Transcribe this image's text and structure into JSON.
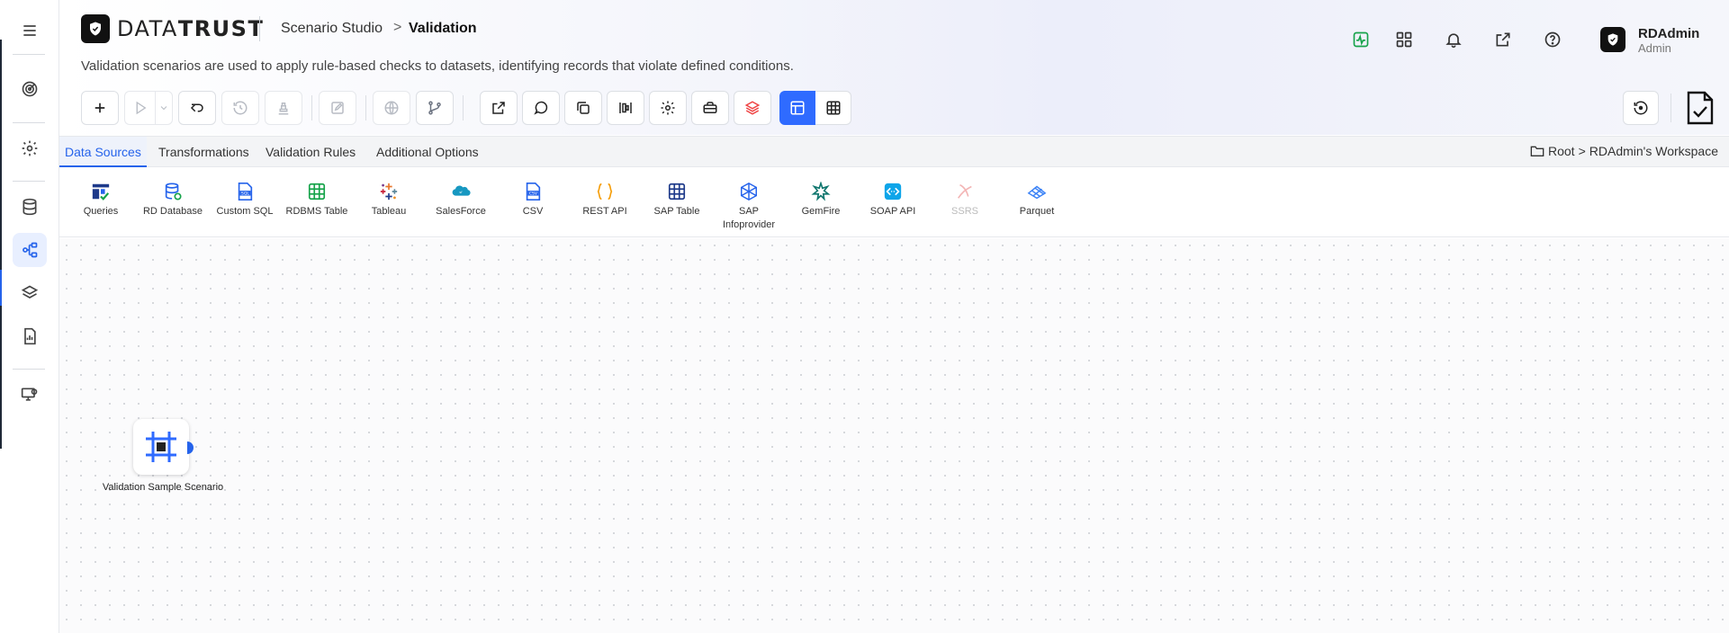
{
  "app": {
    "logo_text_light": "DATA",
    "logo_text_bold": "TRUST",
    "breadcrumb": [
      "Scenario Studio",
      "Validation"
    ],
    "breadcrumb_separator": ">",
    "subtitle": "Validation scenarios are used to apply rule-based checks to datasets, identifying records that violate defined conditions."
  },
  "header_icons": [
    "activity-icon",
    "apps-grid-icon",
    "bell-icon",
    "external-link-icon",
    "help-icon"
  ],
  "user": {
    "name": "RDAdmin",
    "role": "Admin"
  },
  "sidebar": {
    "items": [
      {
        "icon": "menu-icon"
      },
      {
        "icon": "target-icon"
      },
      {
        "icon": "gear-icon"
      },
      {
        "icon": "database-icon"
      },
      {
        "icon": "workflow-icon",
        "active": true
      },
      {
        "icon": "layers-icon"
      },
      {
        "icon": "report-icon"
      },
      {
        "icon": "monitor-settings-icon"
      }
    ]
  },
  "toolbar": {
    "buttons": [
      "add",
      "run",
      "run-dropdown",
      "undo",
      "history",
      "stamp",
      "edit",
      "globe",
      "branch",
      "export",
      "comment",
      "copy",
      "align",
      "settings",
      "briefcase",
      "layers",
      "layout-view",
      "table-view"
    ],
    "active_view": "layout-view"
  },
  "tabs": {
    "items": [
      "Data Sources",
      "Transformations",
      "Validation Rules",
      "Additional Options"
    ],
    "active": "Data Sources"
  },
  "workspace": {
    "root": "Root",
    "separator": ">",
    "name": "RDAdmin's Workspace"
  },
  "sources": [
    {
      "label": "Queries",
      "icon": "queries-icon"
    },
    {
      "label": "RD Database",
      "icon": "rd-database-icon"
    },
    {
      "label": "Custom SQL",
      "icon": "custom-sql-icon"
    },
    {
      "label": "RDBMS Table",
      "icon": "rdbms-table-icon"
    },
    {
      "label": "Tableau",
      "icon": "tableau-icon"
    },
    {
      "label": "SalesForce",
      "icon": "salesforce-icon"
    },
    {
      "label": "CSV",
      "icon": "csv-icon"
    },
    {
      "label": "REST API",
      "icon": "rest-api-icon"
    },
    {
      "label": "SAP Table",
      "icon": "sap-table-icon"
    },
    {
      "label": "SAP Infoprovider",
      "icon": "sap-infoprovider-icon"
    },
    {
      "label": "GemFire",
      "icon": "gemfire-icon"
    },
    {
      "label": "SOAP API",
      "icon": "soap-api-icon"
    },
    {
      "label": "SSRS",
      "icon": "ssrs-icon",
      "disabled": true
    },
    {
      "label": "Parquet",
      "icon": "parquet-icon"
    }
  ],
  "canvas": {
    "node": {
      "label": "Validation Sample Scenario",
      "icon": "scenario-node-icon"
    }
  },
  "colors": {
    "accent": "#2563eb",
    "primary_button": "#2f6bff"
  }
}
